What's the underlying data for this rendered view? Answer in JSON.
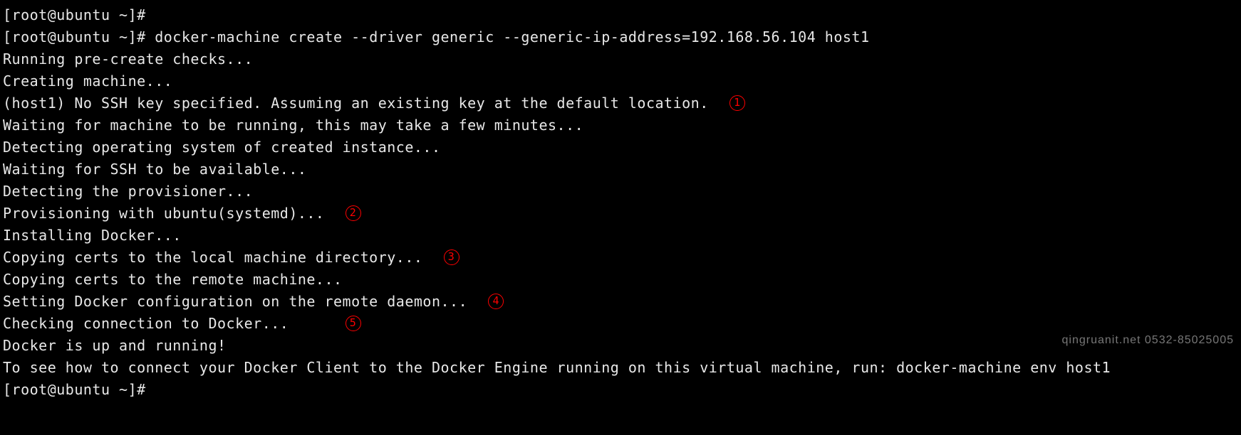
{
  "terminal": {
    "prompt": "[root@ubuntu ~]#",
    "command": "docker-machine create --driver generic --generic-ip-address=192.168.56.104 host1",
    "lines": {
      "l0": "[root@ubuntu ~]# ",
      "l1_prompt": "[root@ubuntu ~]# ",
      "l1_cmd": "docker-machine create --driver generic --generic-ip-address=192.168.56.104 host1",
      "l2": "Running pre-create checks...",
      "l3": "Creating machine...",
      "l4": "(host1) No SSH key specified. Assuming an existing key at the default location.  ",
      "l5": "Waiting for machine to be running, this may take a few minutes...",
      "l6": "Detecting operating system of created instance...",
      "l7": "Waiting for SSH to be available...",
      "l8": "Detecting the provisioner...",
      "l9": "Provisioning with ubuntu(systemd)...  ",
      "l10": "Installing Docker...",
      "l11": "Copying certs to the local machine directory...  ",
      "l12": "Copying certs to the remote machine...",
      "l13": "Setting Docker configuration on the remote daemon...  ",
      "l14": "Checking connection to Docker...      ",
      "l15": "Docker is up and running!",
      "l16": "To see how to connect your Docker Client to the Docker Engine running on this virtual machine, run: docker-machine env host1",
      "l17": "[root@ubuntu ~]# "
    }
  },
  "annotations": {
    "a1": "1",
    "a2": "2",
    "a3": "3",
    "a4": "4",
    "a5": "5"
  },
  "watermark": "qingruanit.net 0532-85025005"
}
